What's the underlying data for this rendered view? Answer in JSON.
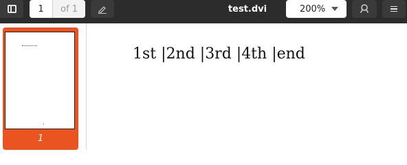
{
  "toolbar": {
    "sidebar_toggle_icon": "sidebar-icon",
    "page_number": "1",
    "page_total": "of 1",
    "annotate_icon": "pencil-icon",
    "title": "test.dvi",
    "zoom": "200%",
    "search_icon": "search-icon",
    "menu_icon": "hamburger-menu-icon"
  },
  "sidebar": {
    "thumbnails": [
      {
        "label": "1",
        "selected": true
      }
    ],
    "accent_color": "#e95420"
  },
  "document": {
    "text": "1st |2nd |3rd |4th |end"
  }
}
